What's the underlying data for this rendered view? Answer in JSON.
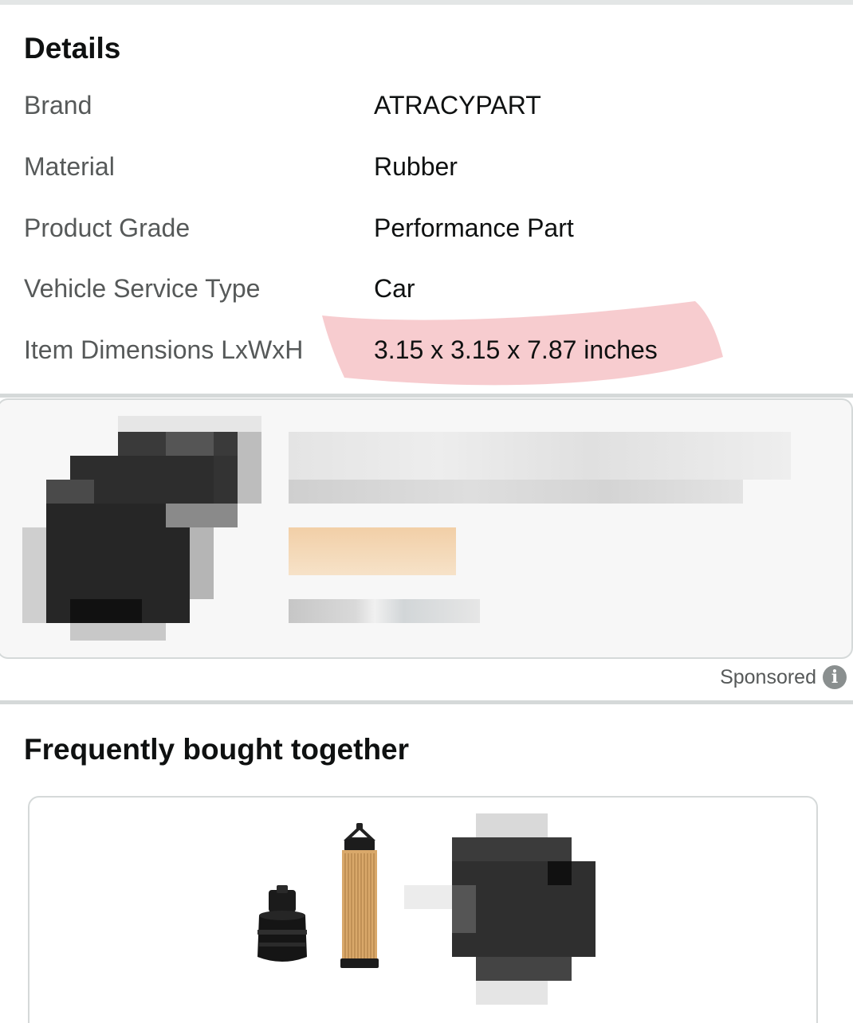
{
  "details": {
    "title": "Details",
    "rows": [
      {
        "label": "Brand",
        "value": "ATRACYPART"
      },
      {
        "label": "Material",
        "value": "Rubber"
      },
      {
        "label": "Product Grade",
        "value": "Performance Part"
      },
      {
        "label": "Vehicle Service Type",
        "value": "Car"
      },
      {
        "label": "Item Dimensions LxWxH",
        "value": "3.15 x 3.15 x 7.87 inches"
      }
    ],
    "highlight_color": "#f7c9cc"
  },
  "sponsored": {
    "label": "Sponsored",
    "icon": "info-icon"
  },
  "frequently_bought": {
    "title": "Frequently bought together",
    "items": [
      {
        "icon": "oil-filter-cap-icon"
      },
      {
        "icon": "oil-filter-cartridge-icon"
      },
      {
        "icon": "pixelated-product-icon"
      }
    ]
  }
}
